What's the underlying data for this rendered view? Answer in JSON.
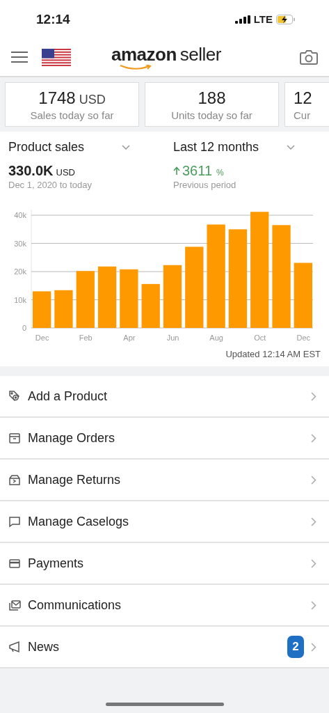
{
  "status_bar": {
    "time": "12:14",
    "network": "LTE"
  },
  "header": {
    "logo": {
      "brand": "amazon",
      "product": "seller"
    }
  },
  "metrics": [
    {
      "value": "1748",
      "unit": "USD",
      "label": "Sales today so far"
    },
    {
      "value": "188",
      "label": "Units today so far"
    },
    {
      "value": "12",
      "label": "Cur"
    }
  ],
  "sales": {
    "metric_selector": "Product sales",
    "period_selector": "Last 12 months",
    "total": "330.0K",
    "total_unit": "USD",
    "date_range": "Dec 1, 2020 to today",
    "change": "3611",
    "change_unit": "%",
    "change_label": "Previous period",
    "chart_data": {
      "type": "bar",
      "grid": true,
      "categories": [
        "Dec",
        null,
        "Feb",
        null,
        "Apr",
        null,
        "Jun",
        null,
        "Aug",
        null,
        "Oct",
        null,
        "Dec"
      ],
      "series": [
        {
          "color": "#ff9900",
          "values": [
            13000,
            13400,
            20200,
            21800,
            20800,
            15600,
            22300,
            28800,
            36700,
            35000,
            41200,
            36500,
            23100
          ]
        }
      ],
      "ylim": [
        0,
        42000
      ],
      "yticks": [
        {
          "value": 0,
          "label": "0"
        },
        {
          "value": 10000,
          "label": "10k"
        },
        {
          "value": 20000,
          "label": "20k"
        },
        {
          "value": 30000,
          "label": "30k"
        },
        {
          "value": 40000,
          "label": "40k"
        }
      ]
    },
    "updated": "Updated 12:14 AM EST"
  },
  "menu": [
    {
      "kind": "product",
      "label": "Add a Product"
    },
    {
      "kind": "orders",
      "label": "Manage Orders"
    },
    {
      "kind": "returns",
      "label": "Manage Returns"
    },
    {
      "kind": "caselogs",
      "label": "Manage Caselogs"
    },
    {
      "kind": "payments",
      "label": "Payments"
    },
    {
      "kind": "communications",
      "label": "Communications"
    },
    {
      "kind": "news",
      "label": "News",
      "badge": "2"
    }
  ]
}
